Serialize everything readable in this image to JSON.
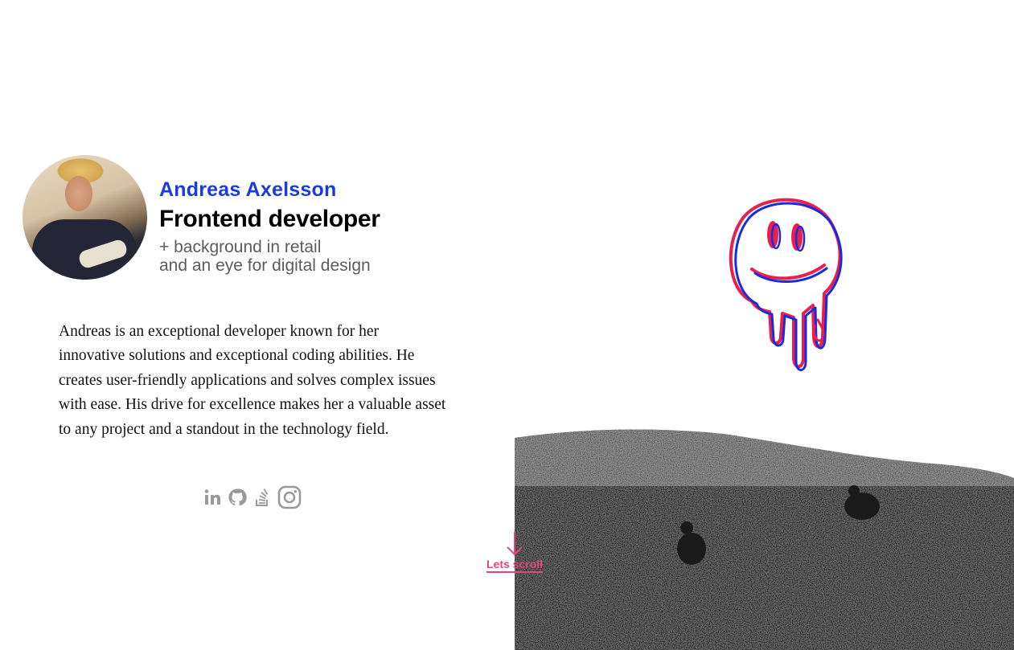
{
  "profile": {
    "name": "Andreas Axelsson",
    "role": "Frontend developer",
    "tagline_line1": "+ background in retail",
    "tagline_line2": "and an eye for digital design"
  },
  "bio": "Andreas is an exceptional developer known for her innovative solutions and exceptional coding abilities. He creates user-friendly applications and solves complex issues with ease. His drive for excellence makes her a valuable asset to any project and a standout in the technology field.",
  "socials": [
    {
      "icon": "linkedin-icon"
    },
    {
      "icon": "github-icon"
    },
    {
      "icon": "stackoverflow-icon"
    },
    {
      "icon": "instagram-icon"
    }
  ],
  "scroll": {
    "label": "Lets scroll",
    "icon": "arrow-down-icon"
  },
  "colors": {
    "name": "#1a3be0",
    "accent": "#e8447a",
    "icon": "#9a9a9a"
  }
}
